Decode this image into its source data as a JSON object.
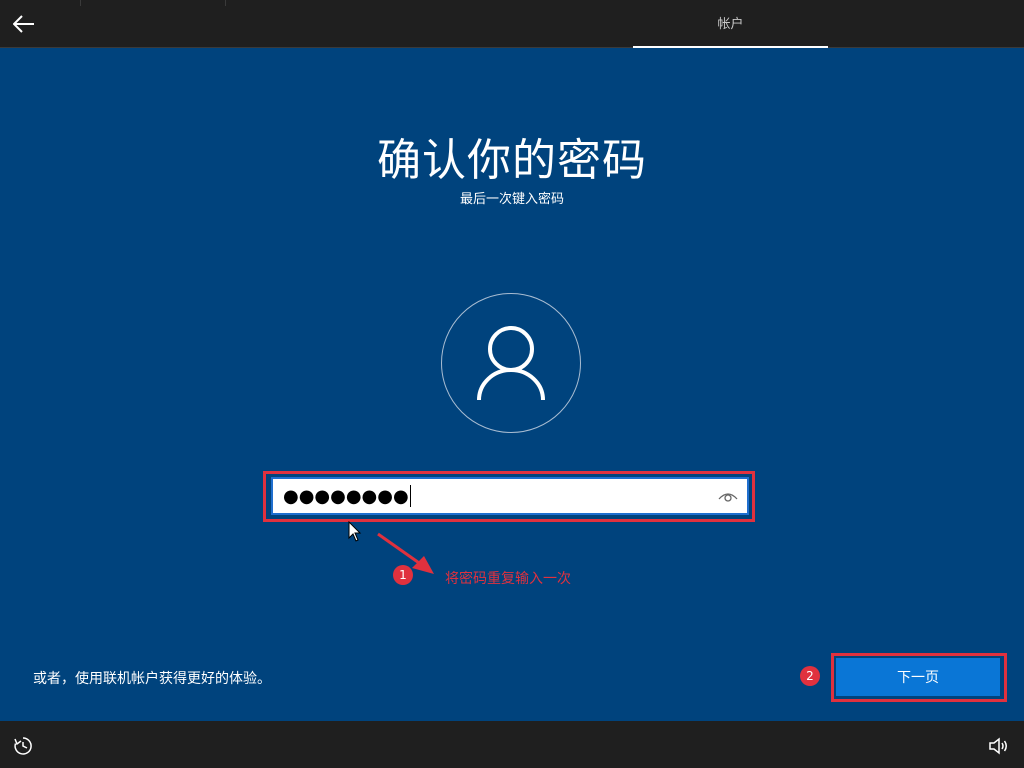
{
  "header": {
    "back_icon": "back-arrow-icon",
    "tab_label": "帐户"
  },
  "main": {
    "title": "确认你的密码",
    "subtitle": "最后一次键入密码",
    "avatar_icon": "user-icon",
    "password": {
      "masked_value": "●●●●●●●●",
      "reveal_icon": "eye-icon"
    },
    "annotation_1": {
      "number": "1",
      "text": "将密码重复输入一次"
    },
    "annotation_2": {
      "number": "2"
    },
    "online_account_link": "或者，使用联机帐户获得更好的体验。",
    "next_button": "下一页"
  },
  "footer": {
    "ease_of_access_icon": "ease-of-access-icon",
    "volume_icon": "volume-icon"
  },
  "colors": {
    "background": "#00437d",
    "bar": "#1f1f1f",
    "accent": "#0a76d6",
    "annotation": "#e0313e"
  }
}
